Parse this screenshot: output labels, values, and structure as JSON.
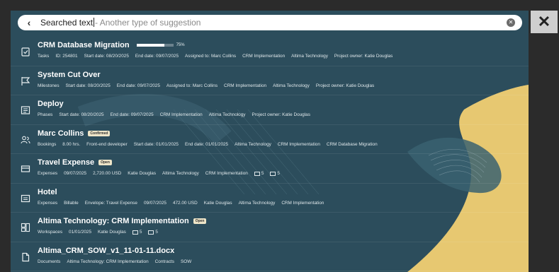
{
  "search": {
    "query": "Searched text",
    "suggestion": "- Another type of suggestion",
    "back_icon": "chevron-left-icon",
    "clear_icon": "clear-icon",
    "close_icon": "close-icon"
  },
  "colors": {
    "panel": "#2c4d5c",
    "accent": "#f1cf72",
    "badge": "#eee5c8"
  },
  "results": [
    {
      "icon": "task-icon",
      "title": "CRM Database Migration",
      "progress": 0.75,
      "progress_label": "75%",
      "meta": [
        "Tasks",
        "ID: 254801",
        "Start date: 08/20/2025",
        "End date: 09/07/2025",
        "Assigned to: Marc Collins",
        "CRM Implementation",
        "Altima Technology",
        "Project owner: Katie Douglas"
      ]
    },
    {
      "icon": "milestone-flag-icon",
      "title": "System Cut Over",
      "meta": [
        "Milestones",
        "Start date: 08/20/2025",
        "End date: 09/07/2025",
        "Assigned to: Marc Collins",
        "CRM Implementation",
        "Altima Technology",
        "Project owner: Katie Douglas"
      ]
    },
    {
      "icon": "phase-icon",
      "title": "Deploy",
      "meta": [
        "Phases",
        "Start date: 08/20/2025",
        "End date: 09/07/2025",
        "CRM Implementation",
        "Altima Technology",
        "Project owner: Katie Douglas"
      ]
    },
    {
      "icon": "people-icon",
      "title": "Marc Collins",
      "badge": "Confirmed",
      "meta": [
        "Bookings",
        "8.00 hrs.",
        "Front-end developer",
        "Start date: 01/01/2025",
        "End date: 01/01/2025",
        "Altima Technology",
        "CRM Implementation",
        "CRM Database Migration"
      ]
    },
    {
      "icon": "expense-icon",
      "title": "Travel Expense",
      "badge": "Open",
      "meta": [
        "Expenses",
        "09/07/2025",
        "2,720.00 USD",
        "Katie Douglas",
        "Altima Technology",
        "CRM Implementation"
      ],
      "counts": [
        "5",
        "5"
      ]
    },
    {
      "icon": "hotel-icon",
      "title": "Hotel",
      "meta": [
        "Expenses",
        "Billable",
        "Envelope: Travel Expense",
        "09/07/2025",
        "472.00 USD",
        "Katie Douglas",
        "Altima Technology",
        "CRM Implementation"
      ]
    },
    {
      "icon": "workspace-icon",
      "title": "Altima Technology: CRM Implementation",
      "badge": "Open",
      "meta": [
        "Workspaces",
        "01/01/2025",
        "Katie Douglas"
      ],
      "counts": [
        "5",
        "5"
      ]
    },
    {
      "icon": "document-icon",
      "title": "Altima_CRM_SOW_v1_11-01-11.docx",
      "meta": [
        "Documents",
        "Altima Technology: CRM Implementation",
        "Contracts",
        "SOW"
      ]
    }
  ]
}
